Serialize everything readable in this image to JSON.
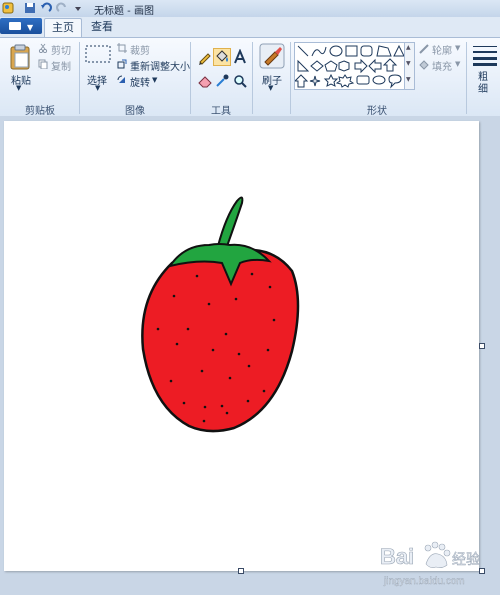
{
  "window": {
    "title": "无标题 - 画图"
  },
  "tabs": [
    {
      "label": "主页"
    },
    {
      "label": "查看"
    }
  ],
  "clipboard": {
    "paste": "粘贴",
    "cut": "剪切",
    "copy": "复制",
    "group": "剪贴板"
  },
  "image": {
    "select": "选择",
    "crop": "裁剪",
    "resize": "重新调整大小",
    "rotate": "旋转",
    "group": "图像"
  },
  "tools": {
    "group": "工具"
  },
  "brushes": {
    "label": "刷子"
  },
  "shapes": {
    "outline": "轮廓",
    "fill": "填充",
    "group": "形状"
  },
  "size": {
    "label": "粗细"
  },
  "watermark": {
    "brand": "Baidu",
    "sub": "jingyan.baidu.com",
    "tag": "经验"
  },
  "colors": {
    "accent": "#1a4f9c",
    "strawberry": "#ed1c24",
    "leaf": "#22a540",
    "ribbon": "#dbe7f5"
  }
}
